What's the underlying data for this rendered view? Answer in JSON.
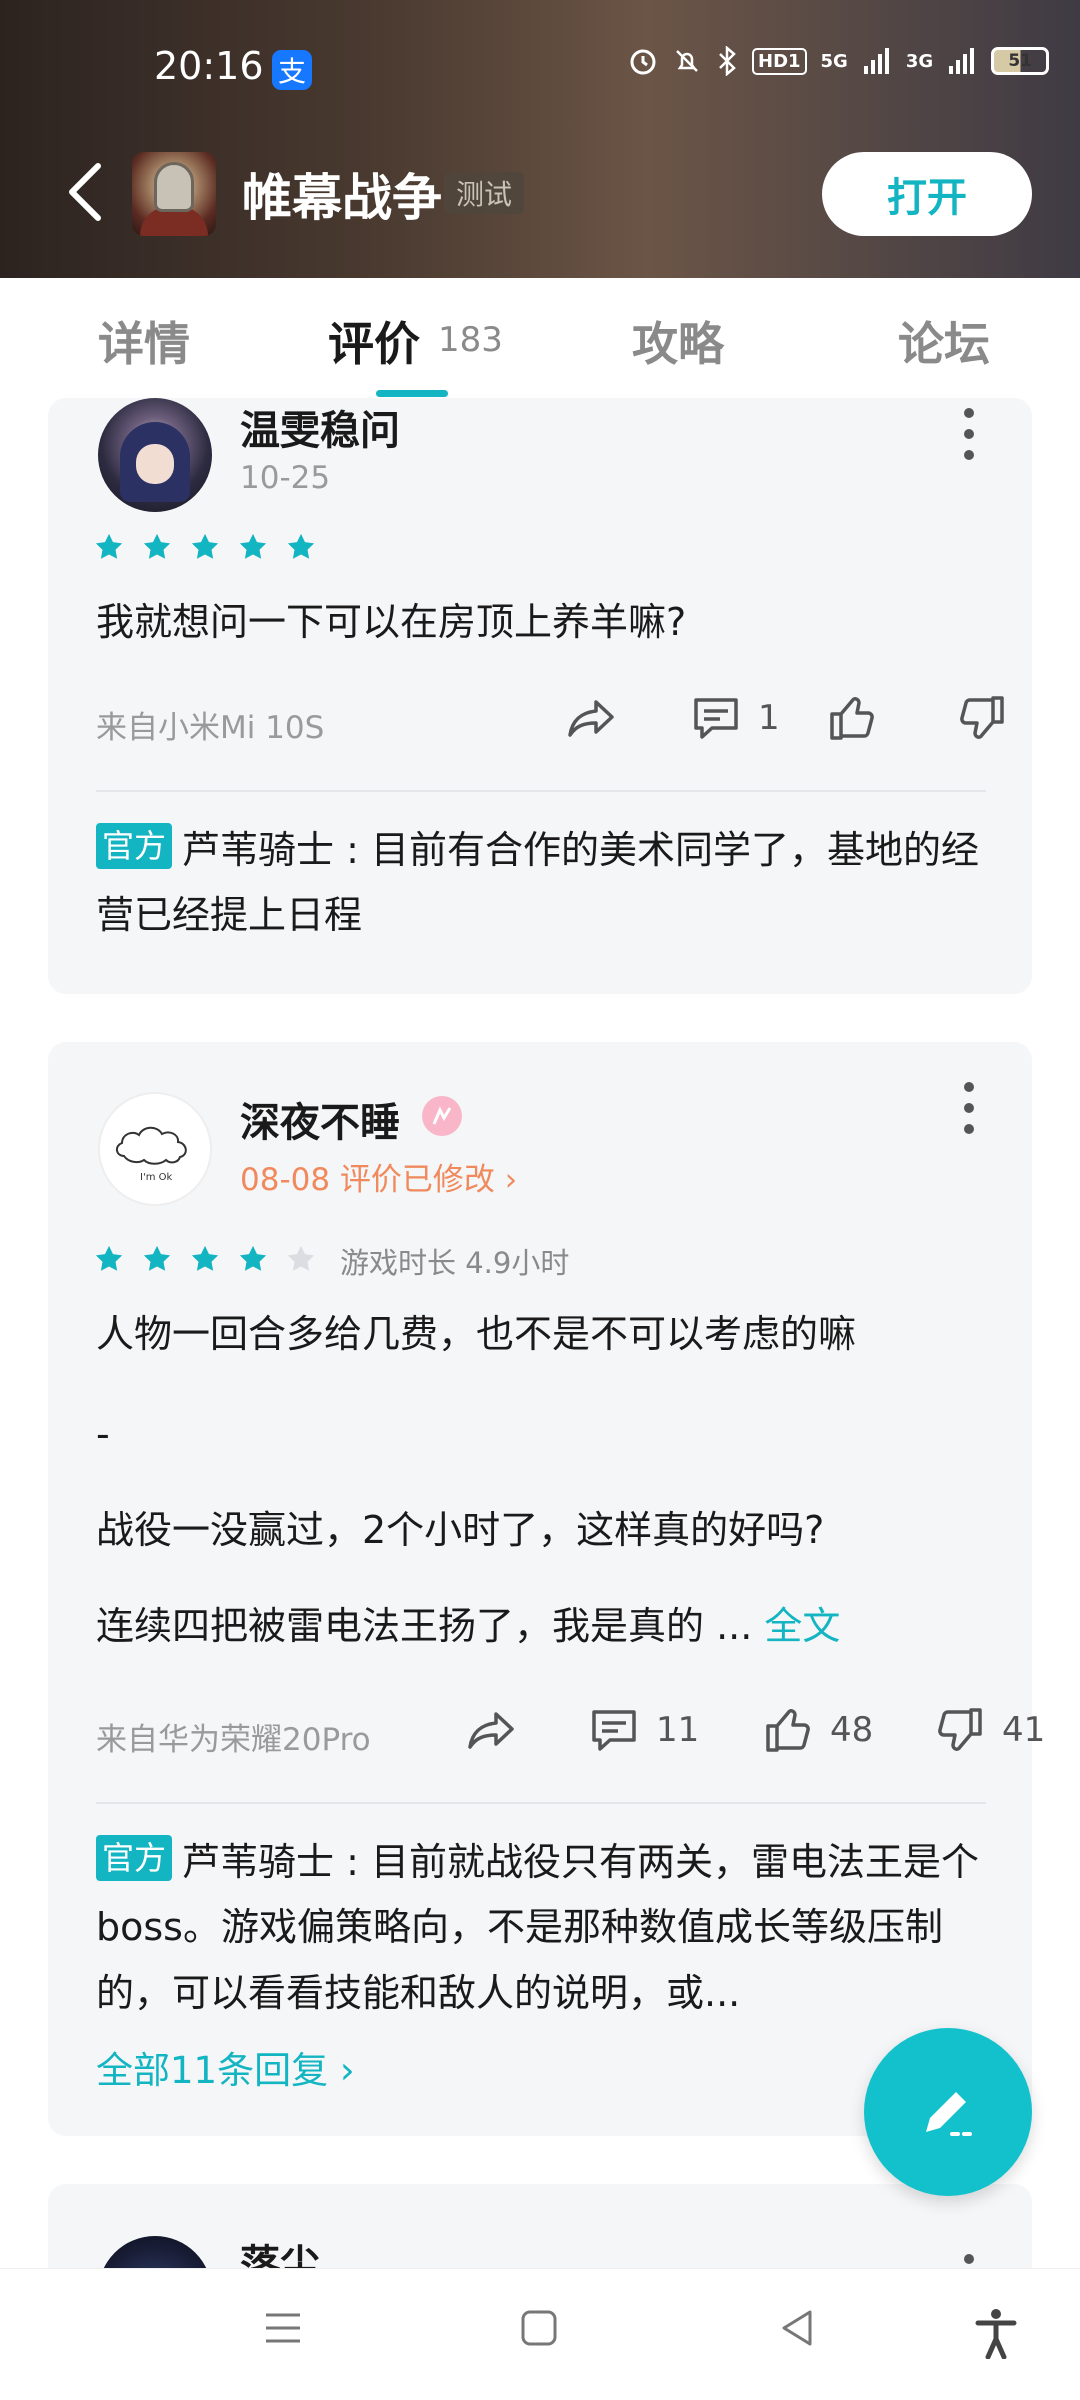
{
  "status_bar": {
    "time": "20:16",
    "alipay_icon": "支",
    "network_5g": "5G",
    "network_3g": "3G",
    "hd_label": "HD1",
    "battery": "51"
  },
  "header": {
    "game_title": "帷幕战争",
    "test_badge": "测试",
    "open_button": "打开"
  },
  "tabs": [
    {
      "label": "详情",
      "active": false
    },
    {
      "label": "评价",
      "active": true,
      "count": "183"
    },
    {
      "label": "攻略",
      "active": false
    },
    {
      "label": "论坛",
      "active": false
    }
  ],
  "reviews": [
    {
      "username": "温雯稳问",
      "date": "10-25",
      "rating": 5,
      "text": "我就想问一下可以在房顶上养羊嘛?",
      "device": "来自小米Mi 10S",
      "comments": "1",
      "likes": "",
      "dislikes": "",
      "official_tag": "官方",
      "official_reply": "芦苇骑士 : 目前有合作的美术同学了，基地的经营已经提上日程"
    },
    {
      "username": "深夜不睡",
      "date": "08-08 评价已修改 ›",
      "avatar_text": "I'm Ok",
      "rating": 4,
      "playtime": "游戏时长 4.9小时",
      "text_lines": [
        "人物一回合多给几费，也不是不可以考虑的嘛",
        "-",
        "战役一没赢过，2个小时了，这样真的好吗?",
        "连续四把被雷电法王扬了，我是真的 ..."
      ],
      "full_text_link": "全文",
      "device": "来自华为荣耀20Pro",
      "comments": "11",
      "likes": "48",
      "dislikes": "41",
      "official_tag": "官方",
      "official_reply": "芦苇骑士 : 目前就战役只有两关，雷电法王是个boss。游戏偏策略向，不是那种数值成长等级压制的，可以看看技能和敌人的说明，或...",
      "all_replies": "全部11条回复 ›"
    },
    {
      "username": "落尘"
    }
  ],
  "colors": {
    "accent": "#13b5c2",
    "edited": "#f08a5d",
    "card_bg": "#f5f6f8"
  }
}
